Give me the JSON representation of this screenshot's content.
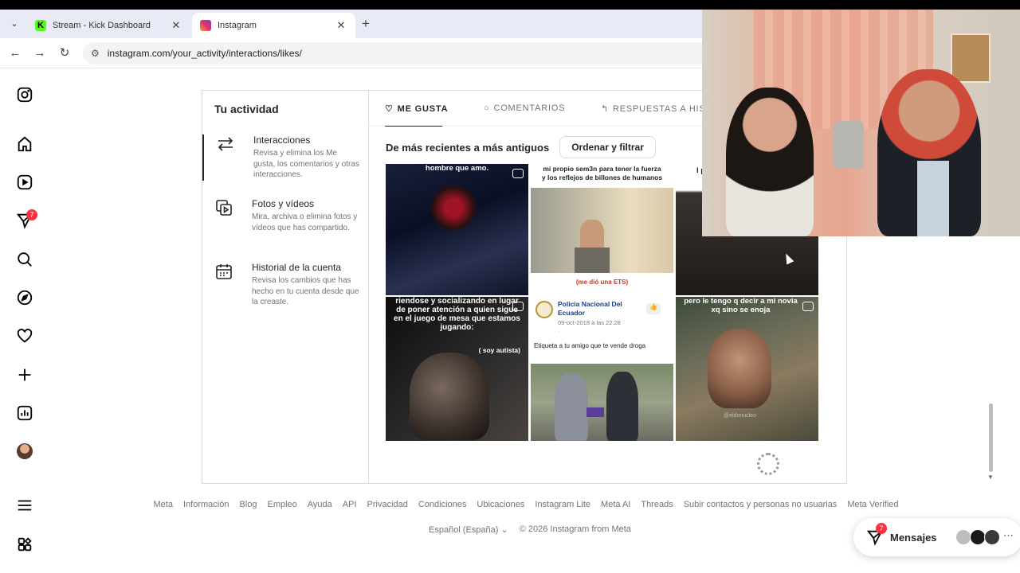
{
  "browser": {
    "tabs": [
      {
        "title": "Stream - Kick Dashboard",
        "active": false,
        "favicon": "kick-logo"
      },
      {
        "title": "Instagram",
        "active": true,
        "favicon": "instagram-logo"
      }
    ],
    "url": "instagram.com/your_activity/interactions/likes/"
  },
  "rail": {
    "notifications_badge": "7"
  },
  "activity": {
    "title": "Tu actividad",
    "items": [
      {
        "title": "Interacciones",
        "desc": "Revisa y elimina los Me gusta, los comentarios y otras interacciones."
      },
      {
        "title": "Fotos y vídeos",
        "desc": "Mira, archiva o elimina fotos y vídeos que has compartido."
      },
      {
        "title": "Historial de la cuenta",
        "desc": "Revisa los cambios que has hecho en tu cuenta desde que la creaste."
      }
    ],
    "tabs": [
      "ME GUSTA",
      "COMENTARIOS",
      "RESPUESTAS A HISTO"
    ],
    "sort_label": "De más recientes a más antiguos",
    "filter_button": "Ordenar y filtrar",
    "posts": [
      {
        "caption": "hombre que amo."
      },
      {
        "caption": "mi propio sem3n para tener la fuerza y los reflejos de billones de humanos",
        "subcaption": "(me dió una ETS)"
      },
      {
        "caption": "l pa"
      },
      {
        "caption": "riendose y socializando en lugar de poner atención a quien sigue en el juego de mesa que estamos jugando:",
        "subcaption": "( soy autista)"
      },
      {
        "page_name": "Policia Nacional Del Ecuador",
        "date": "09-oct-2018 a las 22:28 ·",
        "caption": "Etiqueta a tu amigo que te vende droga"
      },
      {
        "caption": "pero le tengo q decir a mi novia xq sino se enoja",
        "watermark": "@eldonucleo"
      }
    ]
  },
  "footer": {
    "links": [
      "Meta",
      "Información",
      "Blog",
      "Empleo",
      "Ayuda",
      "API",
      "Privacidad",
      "Condiciones",
      "Ubicaciones",
      "Instagram Lite",
      "Meta AI",
      "Threads",
      "Subir contactos y personas no usuarias",
      "Meta Verified"
    ],
    "language": "Español (España)",
    "copyright": "© 2026 Instagram from Meta"
  },
  "messages": {
    "label": "Mensajes",
    "badge": "7"
  }
}
